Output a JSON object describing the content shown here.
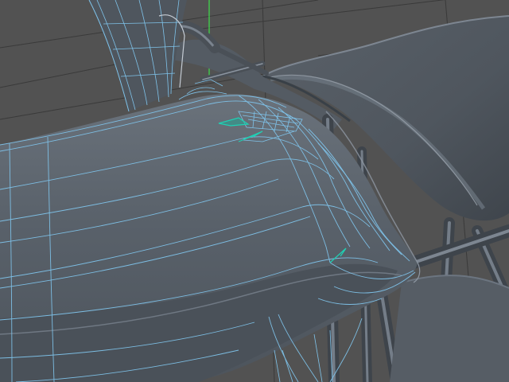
{
  "viewport": {
    "view": "perspective",
    "background": "#525252",
    "grid_color": "#3a3a3a",
    "surface_color": "#5b626b",
    "surface_shadow": "#3e444b",
    "surface_highlight": "#8a939e",
    "wire_color": "#7fc3ea",
    "selected_edge_color": "#1fd1b4",
    "y_axis_color": "#3ee04a"
  },
  "scene": {
    "object": "biplane-wing-assembly",
    "components": [
      "lower-wing",
      "upper-wing",
      "interplane-strut",
      "cabane-strut",
      "fuselage-stub"
    ]
  }
}
